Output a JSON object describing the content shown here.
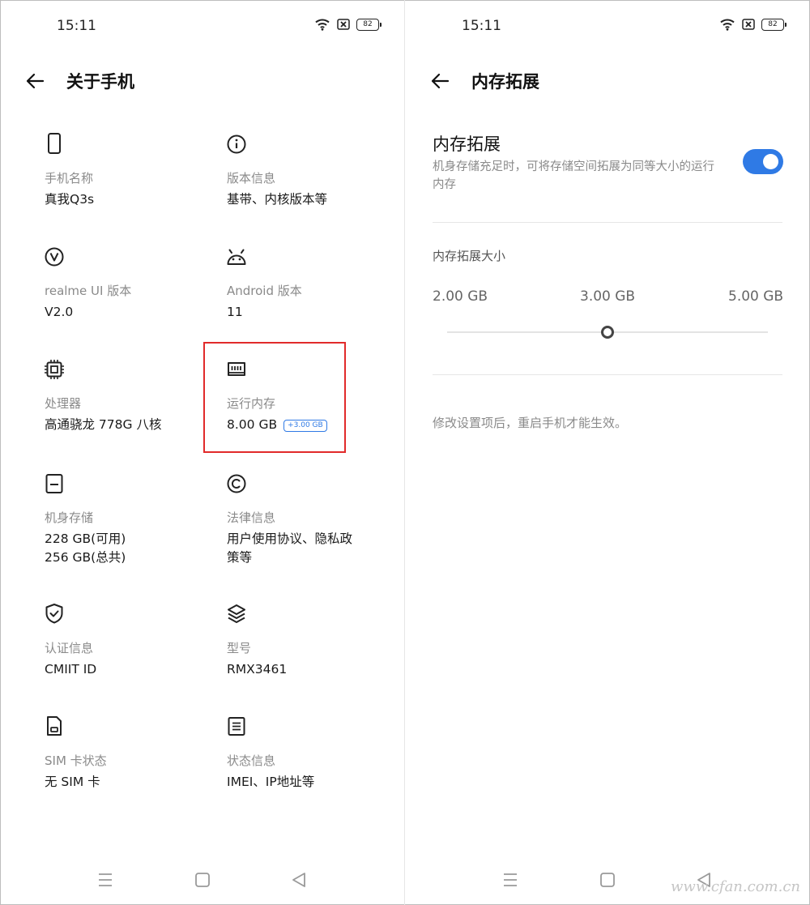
{
  "colors": {
    "accent": "#2f7ae5",
    "highlight": "#e12a2a"
  },
  "left": {
    "status": {
      "time": "15:11",
      "battery": "82"
    },
    "title": "关于手机",
    "items": [
      {
        "icon": "phone-icon",
        "label": "手机名称",
        "value": "真我Q3s"
      },
      {
        "icon": "info-icon",
        "label": "版本信息",
        "value": "基带、内核版本等"
      },
      {
        "icon": "realme-v-icon",
        "label": "realme UI 版本",
        "value": "V2.0"
      },
      {
        "icon": "android-icon",
        "label": "Android 版本",
        "value": "11"
      },
      {
        "icon": "chip-icon",
        "label": "处理器",
        "value": "高通骁龙 778G 八核"
      },
      {
        "icon": "ram-icon",
        "label": "运行内存",
        "value": "8.00 GB",
        "badge": "+3.00 GB"
      },
      {
        "icon": "storage-icon",
        "label": "机身存储",
        "value": "228 GB(可用)",
        "value2": "256 GB(总共)"
      },
      {
        "icon": "copyright-icon",
        "label": "法律信息",
        "value": "用户使用协议、隐私政",
        "value2": "策等"
      },
      {
        "icon": "shield-check-icon",
        "label": "认证信息",
        "value": "CMIIT ID"
      },
      {
        "icon": "layers-icon",
        "label": "型号",
        "value": "RMX3461"
      },
      {
        "icon": "sim-icon",
        "label": "SIM 卡状态",
        "value": "无 SIM 卡"
      },
      {
        "icon": "document-icon",
        "label": "状态信息",
        "value": "IMEI、IP地址等"
      }
    ]
  },
  "right": {
    "status": {
      "time": "15:11",
      "battery": "82"
    },
    "title": "内存拓展",
    "section_title": "内存拓展",
    "section_desc": "机身存储充足时，可将存储空间拓展为同等大小的运行内存",
    "toggle_on": true,
    "size_title": "内存拓展大小",
    "options": [
      "2.00 GB",
      "3.00 GB",
      "5.00 GB"
    ],
    "selected_index": 1,
    "note": "修改设置项后，重启手机才能生效。"
  },
  "watermark": "www.cfan.com.cn"
}
